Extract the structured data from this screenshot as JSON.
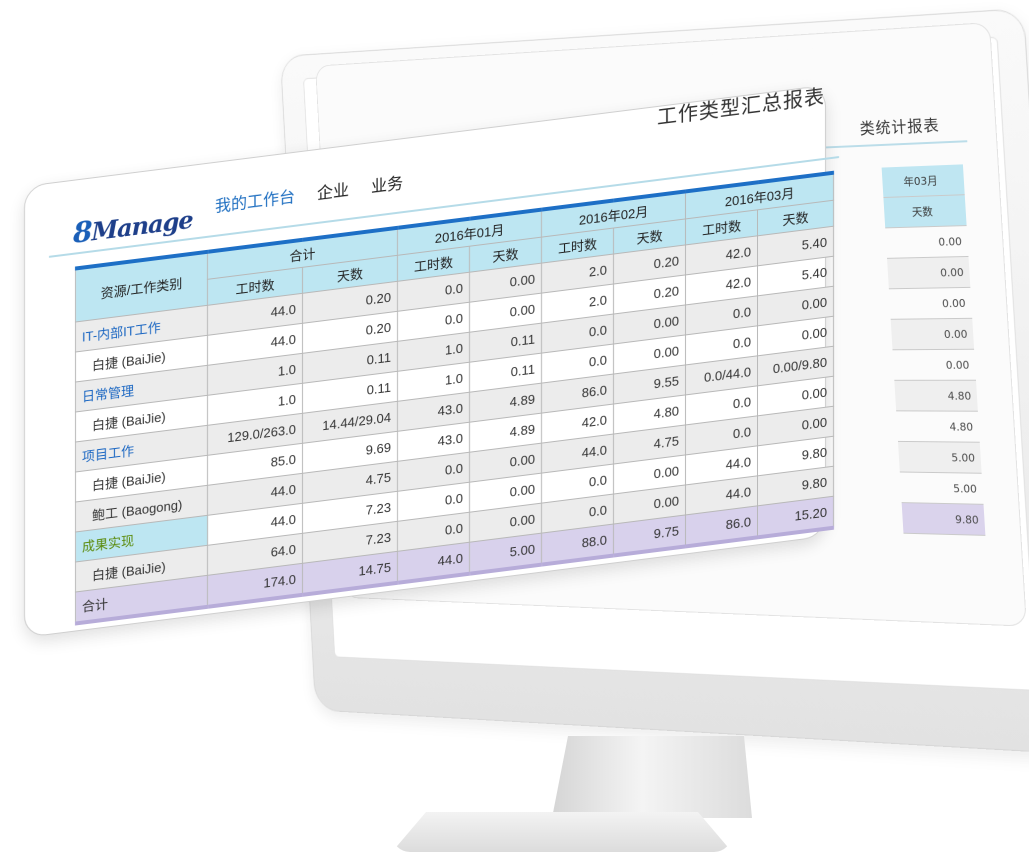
{
  "app": {
    "logo_eight": "8",
    "logo_text": "Manage",
    "nav": [
      "我的工作台",
      "企业",
      "业务"
    ],
    "report_title": "工作类型汇总报表"
  },
  "back_report": {
    "title_fragment": "类统计报表",
    "column_month": "年03月",
    "column_header": "天数",
    "values": [
      "0.00",
      "0.00",
      "0.00",
      "0.00",
      "0.00",
      "4.80",
      "4.80",
      "5.00",
      "5.00",
      "9.80"
    ]
  },
  "table": {
    "corner_header": "资源/工作类别",
    "groups": [
      "合计",
      "2016年01月",
      "2016年02月",
      "2016年03月"
    ],
    "sub_headers": [
      "工时数",
      "天数",
      "工时数",
      "天数",
      "工时数",
      "天数",
      "工时数",
      "天数"
    ],
    "rows": [
      {
        "name": "IT-内部IT工作",
        "type": "cat",
        "cells": [
          "44.0",
          "0.20",
          "0.0",
          "0.00",
          "2.0",
          "0.20",
          "42.0",
          "5.40"
        ]
      },
      {
        "name": "白捷 (BaiJie)",
        "type": "sub",
        "cells": [
          "44.0",
          "0.20",
          "0.0",
          "0.00",
          "2.0",
          "0.20",
          "42.0",
          "5.40"
        ]
      },
      {
        "name": "日常管理",
        "type": "cat",
        "cells": [
          "1.0",
          "0.11",
          "1.0",
          "0.11",
          "0.0",
          "0.00",
          "0.0",
          "0.00"
        ]
      },
      {
        "name": "白捷 (BaiJie)",
        "type": "sub",
        "cells": [
          "1.0",
          "0.11",
          "1.0",
          "0.11",
          "0.0",
          "0.00",
          "0.0",
          "0.00"
        ]
      },
      {
        "name": "项目工作",
        "type": "cat",
        "cells": [
          "129.0/263.0",
          "14.44/29.04",
          "43.0",
          "4.89",
          "86.0",
          "9.55",
          "0.0/44.0",
          "0.00/9.80"
        ]
      },
      {
        "name": "白捷 (BaiJie)",
        "type": "sub",
        "cells": [
          "85.0",
          "9.69",
          "43.0",
          "4.89",
          "42.0",
          "4.80",
          "0.0",
          "0.00"
        ]
      },
      {
        "name": "鲍工 (Baogong)",
        "type": "sub",
        "cells": [
          "44.0",
          "4.75",
          "0.0",
          "0.00",
          "44.0",
          "4.75",
          "0.0",
          "0.00"
        ]
      },
      {
        "name": "成果实现",
        "type": "cat-green",
        "cells": [
          "44.0",
          "7.23",
          "0.0",
          "0.00",
          "0.0",
          "0.00",
          "44.0",
          "9.80"
        ]
      },
      {
        "name": "白捷 (BaiJie)",
        "type": "sub",
        "cells": [
          "64.0",
          "7.23",
          "0.0",
          "0.00",
          "0.0",
          "0.00",
          "44.0",
          "9.80"
        ]
      }
    ],
    "total": {
      "name": "合计",
      "cells": [
        "174.0",
        "14.75",
        "44.0",
        "5.00",
        "88.0",
        "9.75",
        "86.0",
        "15.20"
      ]
    }
  }
}
